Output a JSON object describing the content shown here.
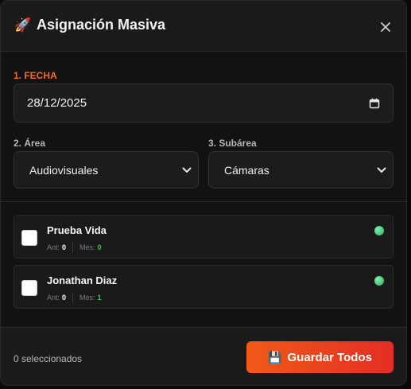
{
  "header": {
    "emoji": "🚀",
    "title": "Asignación Masiva",
    "icon": "close-icon"
  },
  "form": {
    "date_label": "1. FECHA",
    "date_value": "28/12/2025",
    "area_label": "2. Área",
    "area_value": "Audiovisuales",
    "subarea_label": "3. Subárea",
    "subarea_value": "Cámaras"
  },
  "users": [
    {
      "name": "Prueba Vida",
      "ant_label": "Ant:",
      "ant_value": "0",
      "mes_label": "Mes:",
      "mes_value": "0",
      "checked": false,
      "status_color": "#4ade80"
    },
    {
      "name": "Jonathan Diaz",
      "ant_label": "Ant:",
      "ant_value": "0",
      "mes_label": "Mes:",
      "mes_value": "1",
      "checked": false,
      "status_color": "#4ade80"
    }
  ],
  "footer": {
    "selected_count": "0 seleccionados",
    "save_emoji": "💾",
    "save_label": "Guardar Todos"
  },
  "colors": {
    "accent": "#f26b2a",
    "button_start": "#f05a16",
    "button_end": "#e42d25",
    "stat_green": "#35c35c"
  }
}
